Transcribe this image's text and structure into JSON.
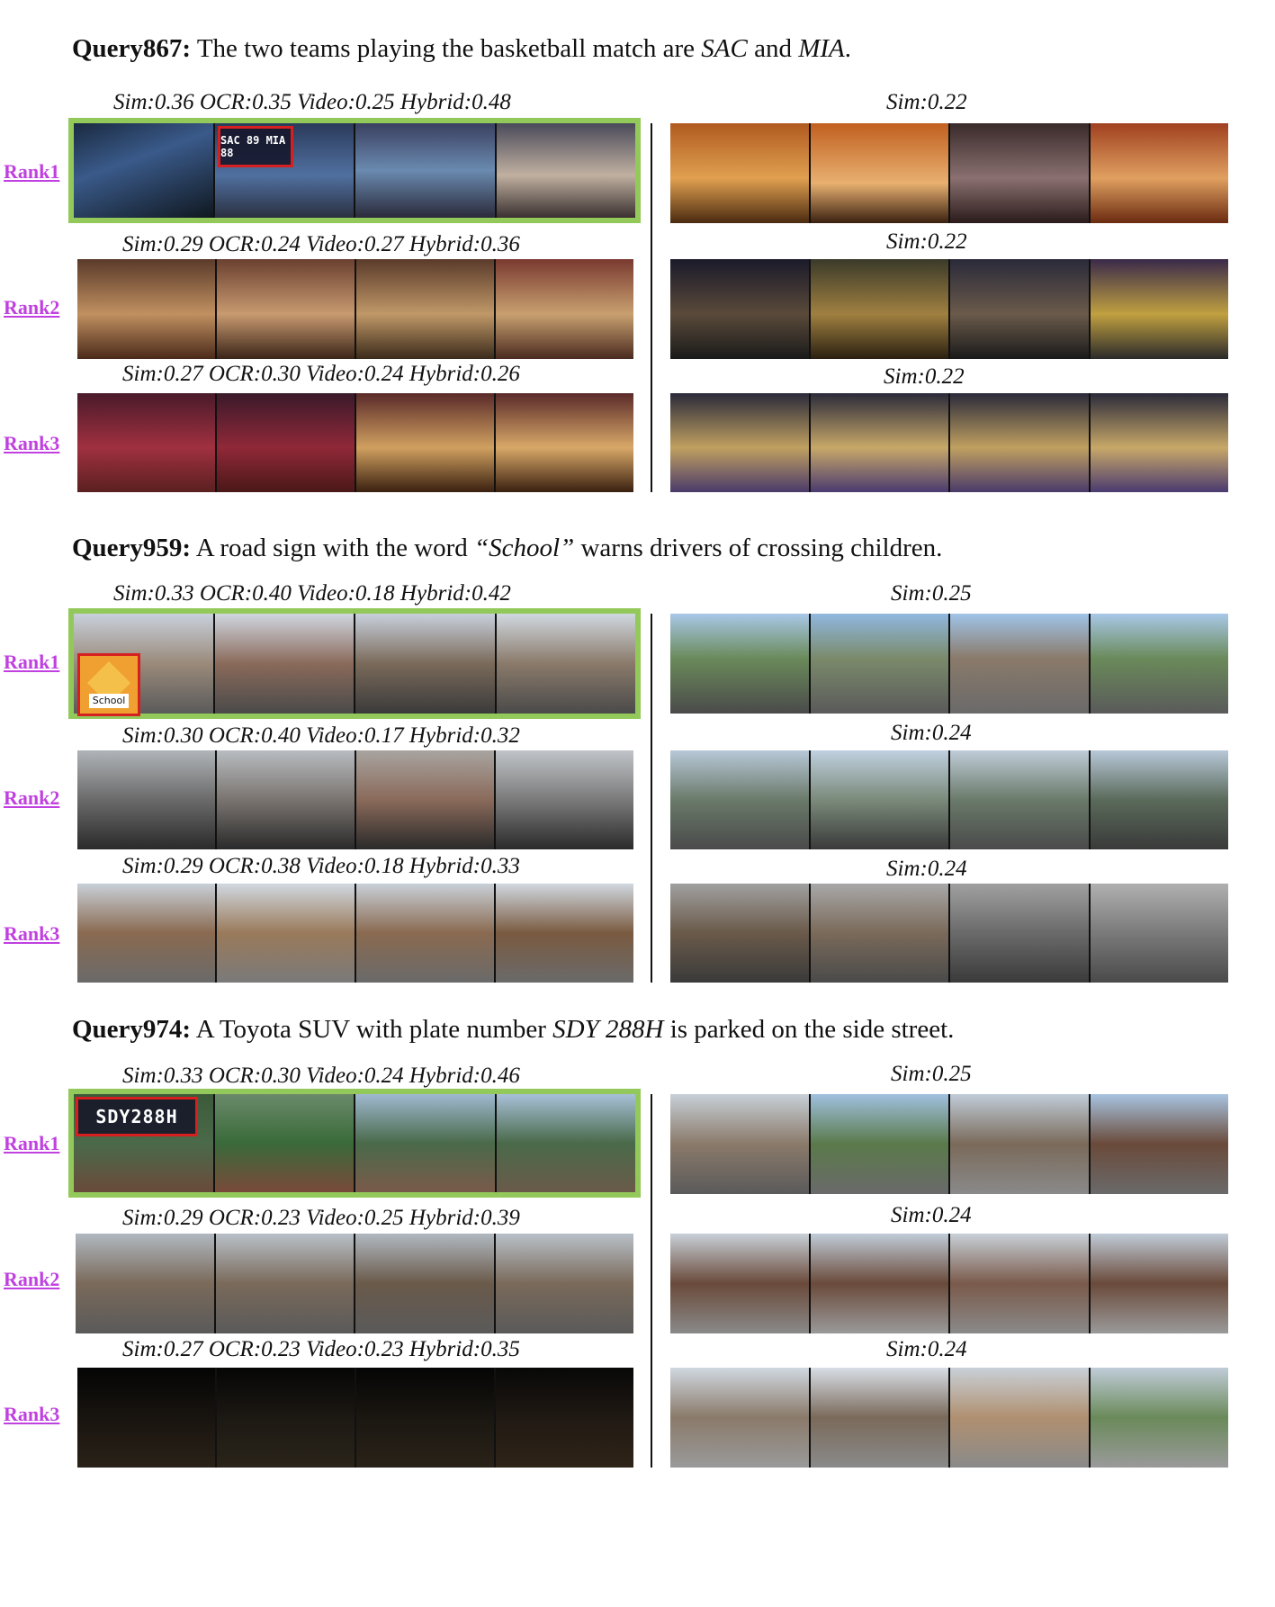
{
  "queries": [
    {
      "id": "Query867:",
      "text": " The two teams playing the basketball match are ",
      "em1": "SAC",
      "mid": " and ",
      "em2": "MIA",
      "end": ".",
      "left": [
        {
          "rank": "Rank1",
          "score": "Sim:0.36  OCR:0.35  Video:0.25  Hybrid:0.48"
        },
        {
          "rank": "Rank2",
          "score": "Sim:0.29  OCR:0.24  Video:0.27  Hybrid:0.36"
        },
        {
          "rank": "Rank3",
          "score": "Sim:0.27  OCR:0.30  Video:0.24  Hybrid:0.26"
        }
      ],
      "right": [
        "Sim:0.22",
        "Sim:0.22",
        "Sim:0.22"
      ],
      "zoom_text": "SAC 89 MIA 88"
    },
    {
      "id": "Query959:",
      "text": " A road sign with the word ",
      "em1": "“School”",
      "mid": " warns drivers of crossing children.",
      "em2": "",
      "end": "",
      "left": [
        {
          "rank": "Rank1",
          "score": "Sim:0.33  OCR:0.40  Video:0.18  Hybrid:0.42"
        },
        {
          "rank": "Rank2",
          "score": "Sim:0.30  OCR:0.40  Video:0.17  Hybrid:0.32"
        },
        {
          "rank": "Rank3",
          "score": "Sim:0.29  OCR:0.38  Video:0.18  Hybrid:0.33"
        }
      ],
      "right": [
        "Sim:0.25",
        "Sim:0.24",
        "Sim:0.24"
      ],
      "zoom_text": "School"
    },
    {
      "id": "Query974:",
      "text": " A Toyota SUV with plate number ",
      "em1": "SDY 288H",
      "mid": " is parked on the side street.",
      "em2": "",
      "end": "",
      "left": [
        {
          "rank": "Rank1",
          "score": "Sim:0.33  OCR:0.30  Video:0.24  Hybrid:0.46"
        },
        {
          "rank": "Rank2",
          "score": "Sim:0.29  OCR:0.23  Video:0.25  Hybrid:0.39"
        },
        {
          "rank": "Rank3",
          "score": "Sim:0.27  OCR:0.23  Video:0.23  Hybrid:0.35"
        }
      ],
      "right": [
        "Sim:0.25",
        "Sim:0.24",
        "Sim:0.24"
      ],
      "zoom_text": "SDY288H"
    }
  ],
  "colors": {
    "rank_link": "#c040e0",
    "highlight_border": "#93c95a",
    "zoom_border": "#d62020"
  }
}
